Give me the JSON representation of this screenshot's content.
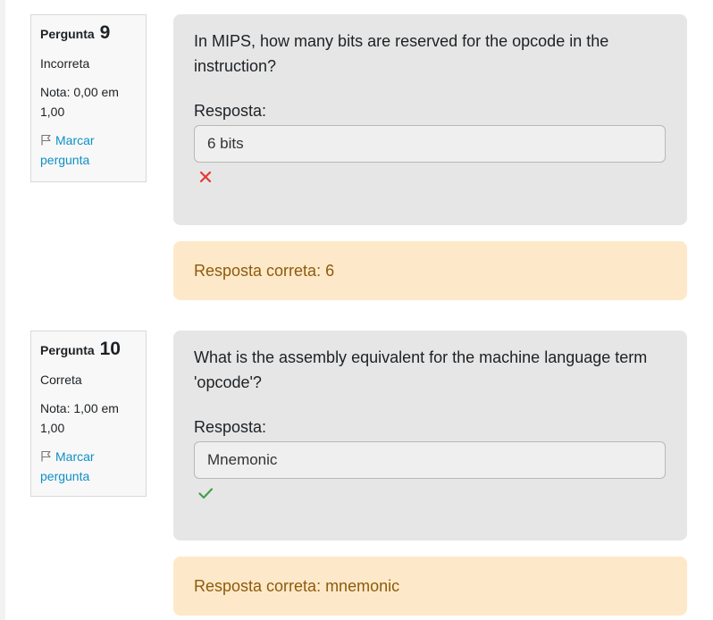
{
  "questions": [
    {
      "label": "Pergunta",
      "number": "9",
      "state": "Incorreta",
      "grade": "Nota: 0,00 em 1,00",
      "flag_label": "Marcar pergunta",
      "text": "In MIPS, how many bits are reserved for the opcode in the instruction?",
      "answer_label": "Resposta:",
      "answer_value": "6 bits",
      "result_icon": "cross-icon",
      "result_color": "#e53935",
      "correct_answer": "Resposta correta: 6"
    },
    {
      "label": "Pergunta",
      "number": "10",
      "state": "Correta",
      "grade": "Nota: 1,00 em 1,00",
      "flag_label": "Marcar pergunta",
      "text": "What is the assembly equivalent for the machine language term 'opcode'?",
      "answer_label": "Resposta:",
      "answer_value": "Mnemonic",
      "result_icon": "check-icon",
      "result_color": "#43a047",
      "correct_answer": "Resposta correta: mnemonic"
    }
  ],
  "colors": {
    "link": "#0f8fc5",
    "feedback_bg": "#fde9c9",
    "feedback_text": "#8e5a0b",
    "question_bg": "#e6e6e6"
  }
}
